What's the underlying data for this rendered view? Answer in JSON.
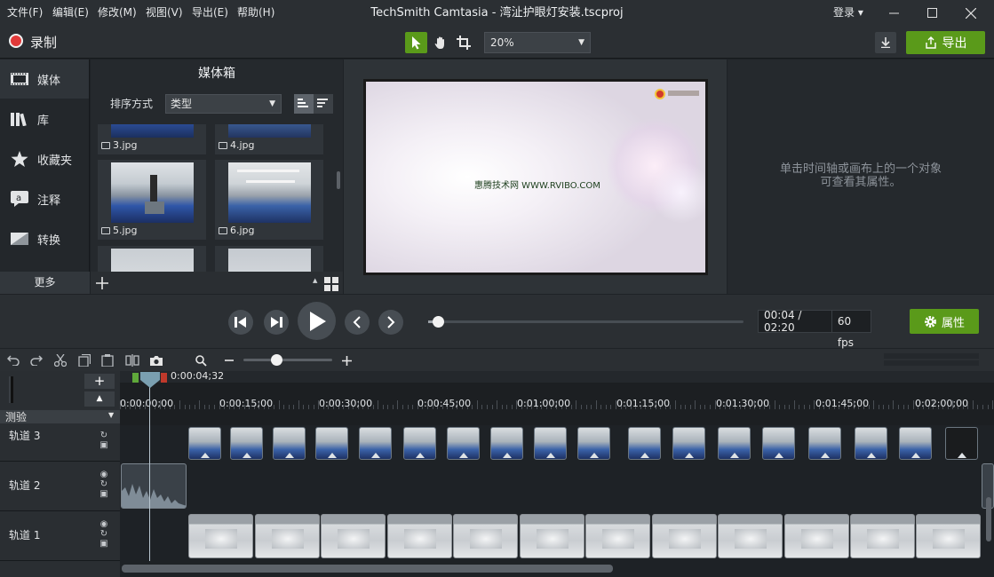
{
  "window": {
    "title": "TechSmith Camtasia - 湾沚护眼灯安装.tscproj",
    "menu": [
      "文件(F)",
      "编辑(E)",
      "修改(M)",
      "视图(V)",
      "导出(E)",
      "帮助(H)"
    ],
    "login": "登录 ▾"
  },
  "toolbar": {
    "record_label": "录制",
    "zoom": "20%",
    "export_label": "导出"
  },
  "leftnav": {
    "items": [
      "媒体",
      "库",
      "收藏夹",
      "注释",
      "转换"
    ],
    "more": "更多"
  },
  "media_bin": {
    "title": "媒体箱",
    "sort_label": "排序方式",
    "sort_value": "类型",
    "items": [
      "3.jpg",
      "4.jpg",
      "5.jpg",
      "6.jpg"
    ]
  },
  "canvas": {
    "overlay_text": "惠腾技术网 WWW.RVIBO.COM"
  },
  "properties": {
    "hint_line1": "单击时间轴或画布上的一个对象",
    "hint_line2": "可查看其属性。"
  },
  "playback": {
    "time": "00:04 / 02:20",
    "fps": "60 fps",
    "progress": 0.03,
    "properties_button": "属性"
  },
  "timeline": {
    "playhead_time": "0:00:04;32",
    "ruler_labels": [
      "0:00:00;00",
      "0:00:15;00",
      "0:00:30;00",
      "0:00:45;00",
      "0:01:00;00",
      "0:01:15;00",
      "0:01:30;00",
      "0:01:45;00",
      "0:02:00;00"
    ],
    "marker_group": "测验",
    "tracks": [
      "轨道 3",
      "轨道 2",
      "轨道 1"
    ]
  },
  "colors": {
    "accent_green": "#5a9a1a",
    "record_red": "#e23a3a"
  }
}
